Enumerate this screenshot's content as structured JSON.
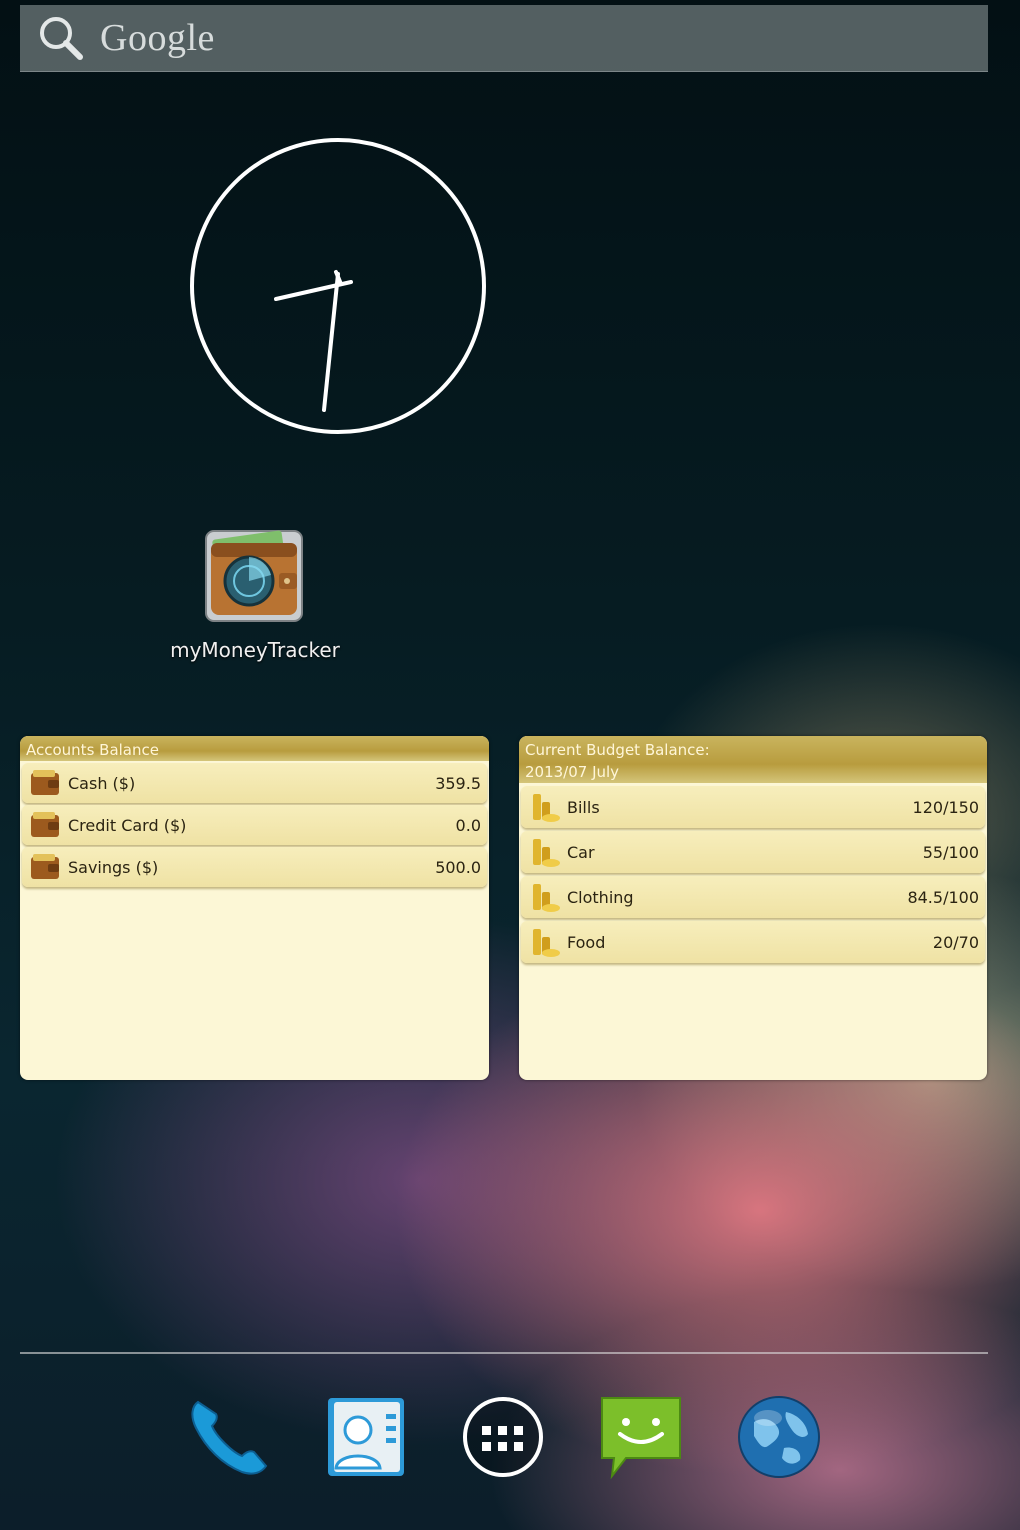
{
  "search": {
    "label": "Google",
    "icon": "search-icon"
  },
  "clock": {
    "icon": "analog-clock"
  },
  "app": {
    "label": "myMoneyTracker",
    "icon": "wallet-radar-icon"
  },
  "accounts_widget": {
    "title": "Accounts Balance",
    "rows": [
      {
        "label": "Cash ($)",
        "value": "359.5"
      },
      {
        "label": "Credit Card ($)",
        "value": "0.0"
      },
      {
        "label": "Savings ($)",
        "value": "500.0"
      }
    ]
  },
  "budget_widget": {
    "title": "Current Budget Balance:",
    "period": "2013/07 July",
    "rows": [
      {
        "label": "Bills",
        "value": "120/150"
      },
      {
        "label": "Car",
        "value": "55/100"
      },
      {
        "label": "Clothing",
        "value": "84.5/100"
      },
      {
        "label": "Food",
        "value": "20/70"
      }
    ]
  },
  "dock": [
    "phone-icon",
    "contacts-icon",
    "app-drawer-icon",
    "messaging-icon",
    "browser-globe-icon"
  ],
  "colors": {
    "widget_bg": "#fcf7d6",
    "widget_header": "#b89c3e",
    "row_bg": "#f2e6aa"
  }
}
